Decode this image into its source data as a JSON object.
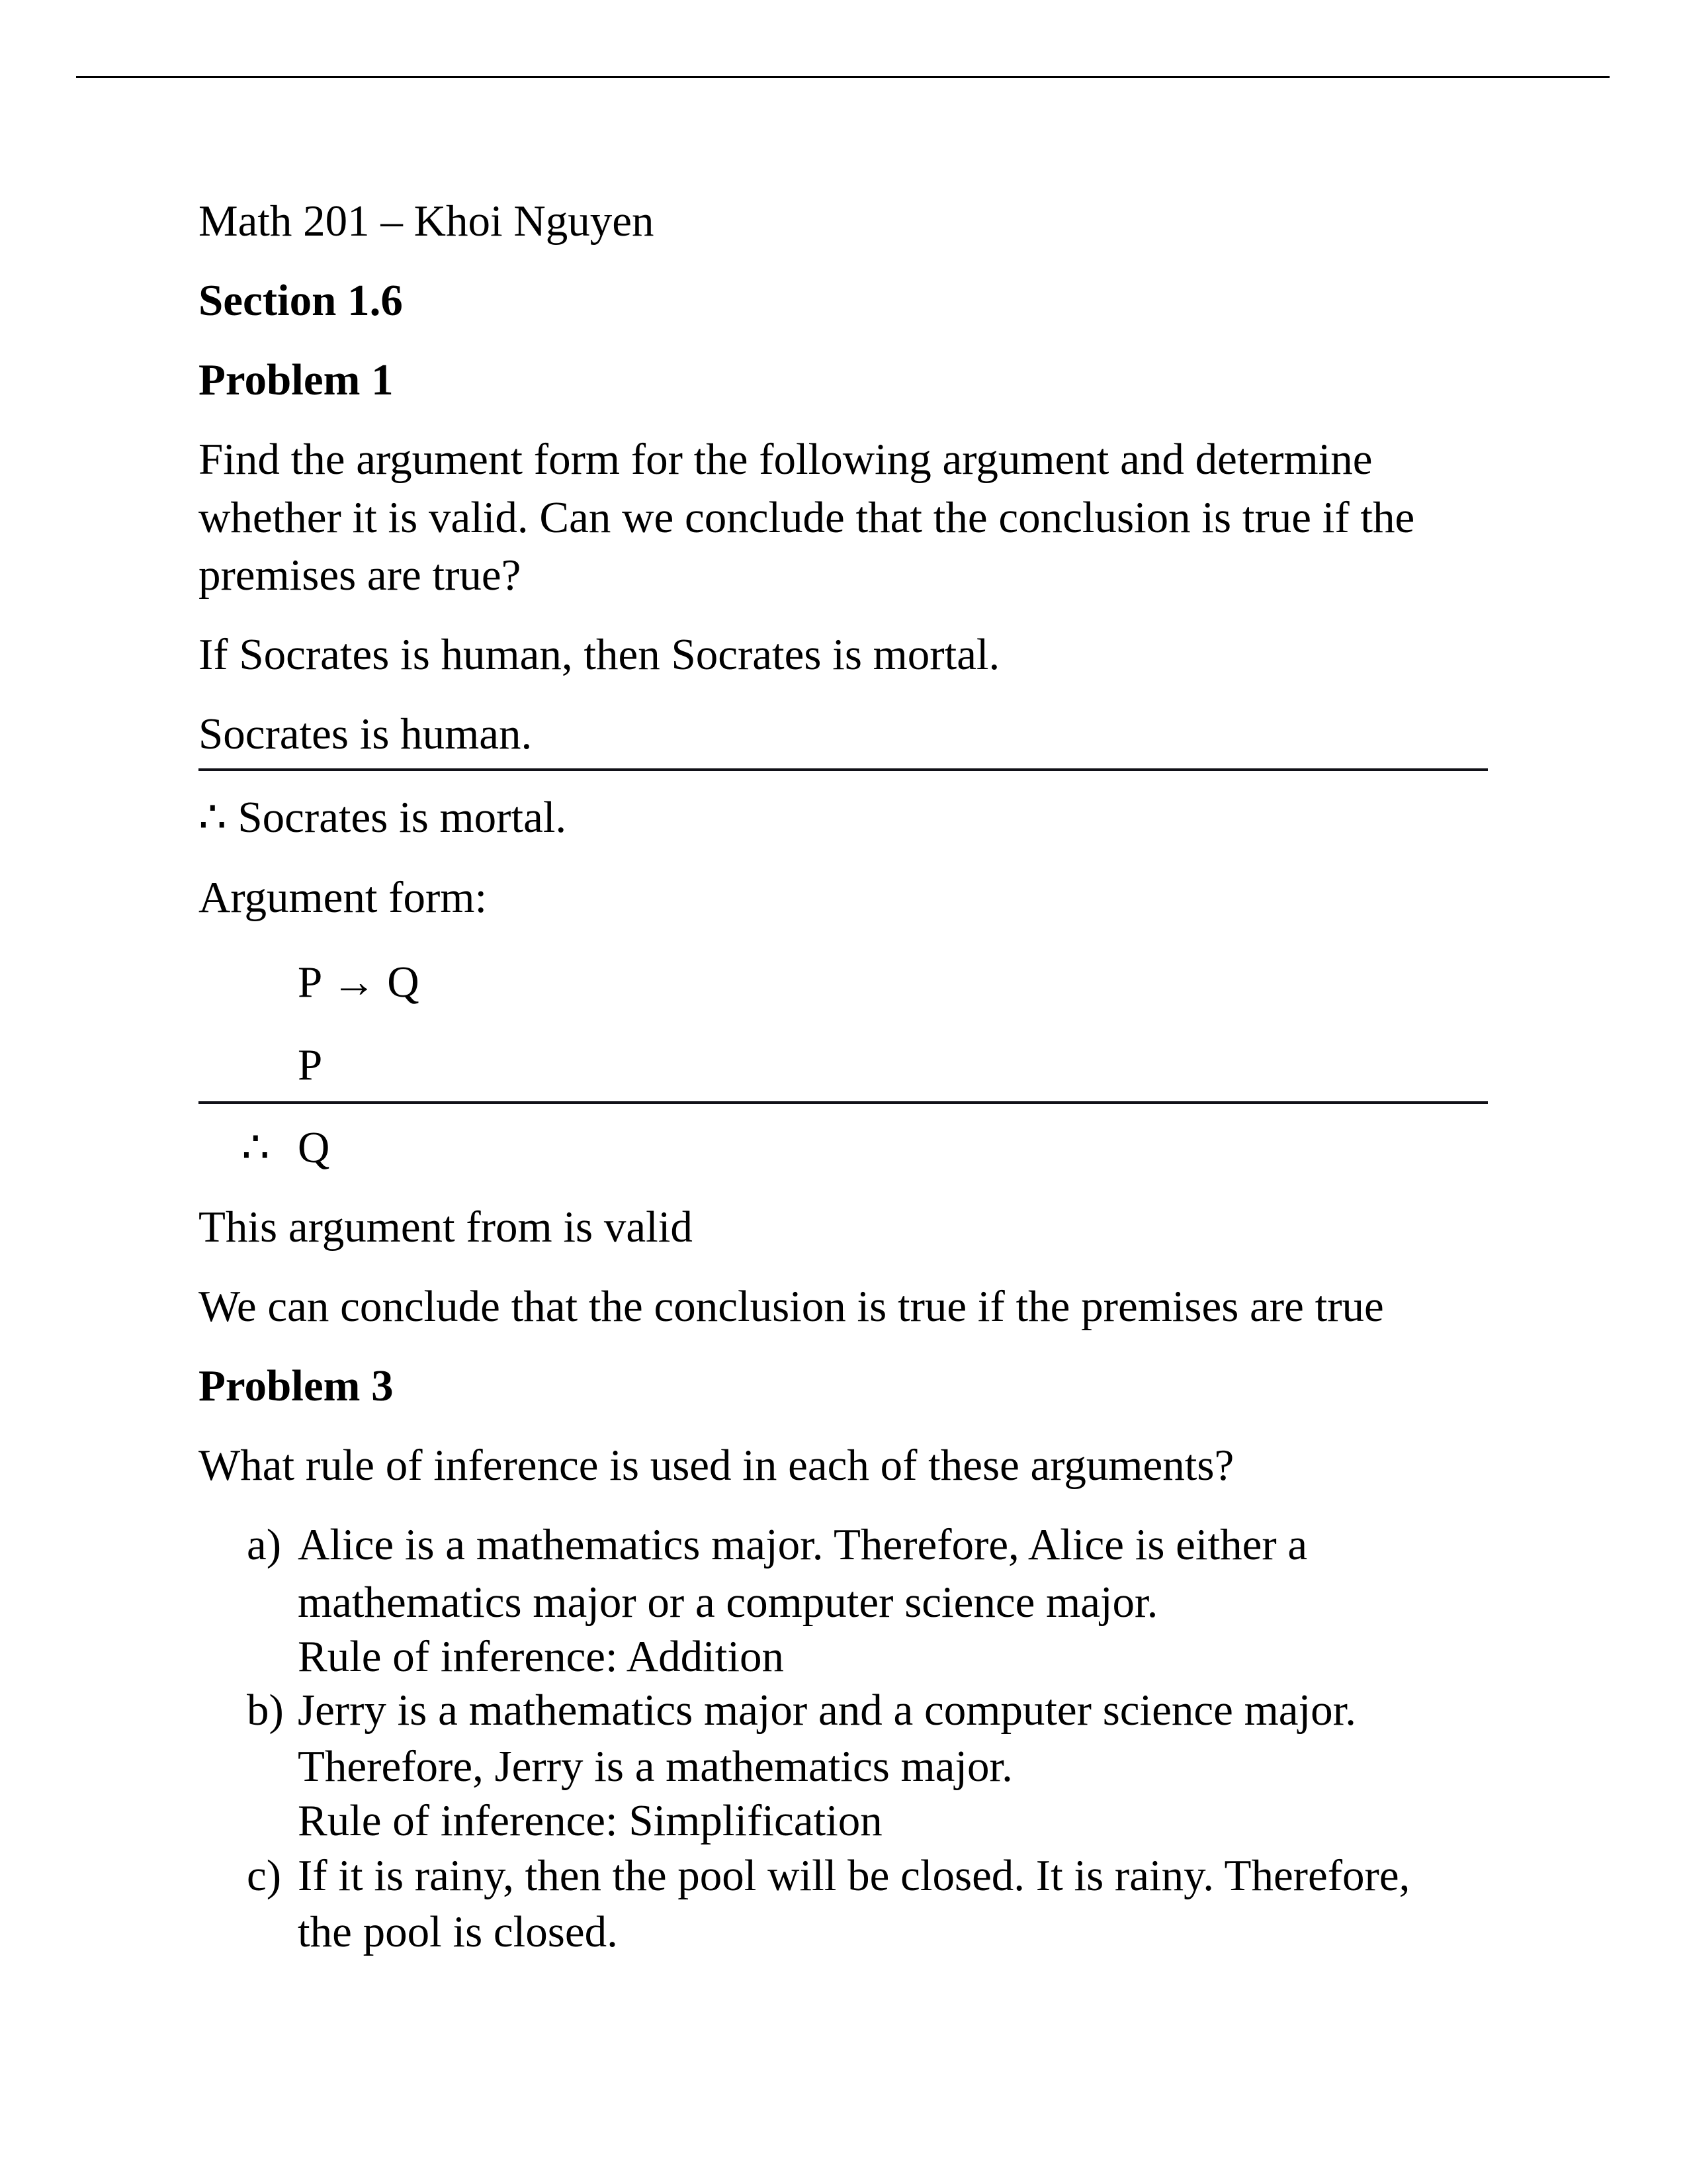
{
  "header": {
    "course_line": "Math 201 – Khoi Nguyen",
    "section": "Section 1.6"
  },
  "problem1": {
    "title": "Problem 1",
    "question_lines": [
      "Find the argument form for the following argument and determine",
      "whether it is valid. Can we conclude that the conclusion is true if the",
      "premises are true?"
    ],
    "premise1": "If Socrates is human, then Socrates is mortal.",
    "premise2": "Socrates is human.",
    "conclusion": "∴ Socrates is mortal.",
    "form_label": "Argument form:",
    "form_premise1": "P → Q",
    "form_premise2": "P",
    "form_therefore": "∴",
    "form_conclusion": "Q",
    "answer_valid": "This argument from is valid",
    "answer_conclude": "We can conclude that the conclusion is true if the premises are true"
  },
  "problem3": {
    "title": "Problem 3",
    "question": "What rule of inference is used in each of these arguments?",
    "items": [
      {
        "label": "a)",
        "lines": [
          "Alice is a mathematics major. Therefore, Alice is either a",
          "mathematics major or a computer science major.",
          "Rule of inference: Addition"
        ]
      },
      {
        "label": "b)",
        "lines": [
          "Jerry is a mathematics major and a computer science major.",
          "Therefore, Jerry is a mathematics major.",
          "Rule of inference: Simplification"
        ]
      },
      {
        "label": "c)",
        "lines": [
          "If it is rainy, then the pool will be closed. It is rainy. Therefore,",
          "the pool is closed."
        ]
      }
    ]
  }
}
